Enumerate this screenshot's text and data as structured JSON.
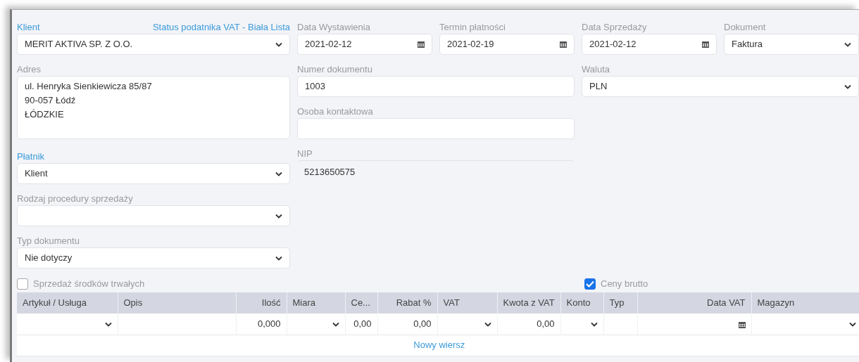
{
  "client": {
    "label": "Klient",
    "accent": true,
    "status_link": "Status podatnika VAT - Biała Lista",
    "value": "MERIT AKTIVA SP. Z O.O."
  },
  "dates": [
    {
      "label": "Data Wystawienia",
      "accent": false,
      "value": "2021-02-12"
    },
    {
      "label": "Termin płatności",
      "accent": false,
      "value": "2021-02-19"
    },
    {
      "label": "Data Sprzedaży",
      "accent": false,
      "value": "2021-02-12"
    }
  ],
  "document": {
    "label": "Dokument",
    "accent": false,
    "value": "Faktura"
  },
  "address": {
    "label": "Adres",
    "accent": false,
    "lines": [
      "ul. Henryka Sienkiewicza 85/87",
      "90-057 Łódź",
      "ŁÓDZKIE"
    ]
  },
  "doc_number": {
    "label": "Numer dokumentu",
    "accent": false,
    "value": "1003"
  },
  "currency": {
    "label": "Waluta",
    "accent": false,
    "value": "PLN"
  },
  "contact": {
    "label": "Osoba kontaktowa",
    "accent": false
  },
  "payer": {
    "label": "Płatnik",
    "accent": true,
    "value": "Klient"
  },
  "nip": {
    "label": "NIP",
    "accent": false,
    "value": "5213650575"
  },
  "sale_procedure": {
    "label": "Rodzaj procedury sprzedaży",
    "accent": false
  },
  "doc_type": {
    "label": "Typ dokumentu",
    "accent": false,
    "value": "Nie dotyczy"
  },
  "checkboxes": [
    {
      "label": "Sprzedaż środków trwałych",
      "checked": false
    },
    {
      "label": "Ceny brutto",
      "checked": true
    }
  ],
  "table": {
    "columns": [
      {
        "label": "Artykuł / Usługa",
        "kind": "text"
      },
      {
        "label": "Opis",
        "kind": "text"
      },
      {
        "label": "Ilość",
        "kind": "numeric"
      },
      {
        "label": "Miara",
        "kind": "text"
      },
      {
        "label": "Ce...",
        "kind": "text"
      },
      {
        "label": "Rabat %",
        "kind": "numeric"
      },
      {
        "label": "VAT",
        "kind": "text"
      },
      {
        "label": "Kwota z VAT",
        "kind": "numeric"
      },
      {
        "label": "Konto",
        "kind": "text"
      },
      {
        "label": "Typ",
        "kind": "text"
      },
      {
        "label": "Data VAT",
        "kind": "numeric"
      },
      {
        "label": "Magazyn",
        "kind": "text"
      }
    ],
    "rows": [
      {
        "cells": [
          {
            "kind": "select"
          },
          {
            "kind": "text"
          },
          {
            "kind": "text",
            "value": "0,000"
          },
          {
            "kind": "select"
          },
          {
            "kind": "text",
            "value": "0,00"
          },
          {
            "kind": "text",
            "value": "0,00"
          },
          {
            "kind": "select"
          },
          {
            "kind": "text",
            "value": "0,00"
          },
          {
            "kind": "select"
          },
          {
            "kind": "text"
          },
          {
            "kind": "date"
          },
          {
            "kind": "select"
          }
        ]
      }
    ],
    "add_row": "Nowy wiersz"
  }
}
